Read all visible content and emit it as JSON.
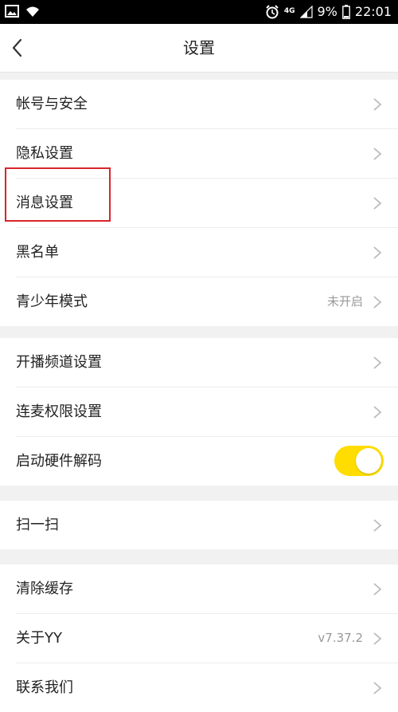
{
  "status_bar": {
    "battery": "9%",
    "time": "22:01",
    "network": "4G",
    "icons": [
      "image-icon",
      "wifi-icon",
      "alarm-icon",
      "signal-icon",
      "battery-icon"
    ]
  },
  "header": {
    "title": "设置",
    "back_icon": "chevron-left-icon"
  },
  "groups": [
    {
      "items": [
        {
          "label": "帐号与安全"
        },
        {
          "label": "隐私设置"
        },
        {
          "label": "消息设置"
        },
        {
          "label": "黑名单"
        },
        {
          "label": "青少年模式",
          "value": "未开启"
        }
      ]
    },
    {
      "items": [
        {
          "label": "开播频道设置"
        },
        {
          "label": "连麦权限设置"
        },
        {
          "label": "启动硬件解码",
          "toggle": true
        }
      ]
    },
    {
      "items": [
        {
          "label": "扫一扫"
        }
      ]
    },
    {
      "items": [
        {
          "label": "清除缓存"
        },
        {
          "label": "关于YY",
          "value": "v7.37.2"
        },
        {
          "label": "联系我们"
        }
      ]
    }
  ],
  "colors": {
    "accent_toggle": "#ffdd00",
    "highlight_box": "#d9252b",
    "background": "#f1f1f1"
  }
}
